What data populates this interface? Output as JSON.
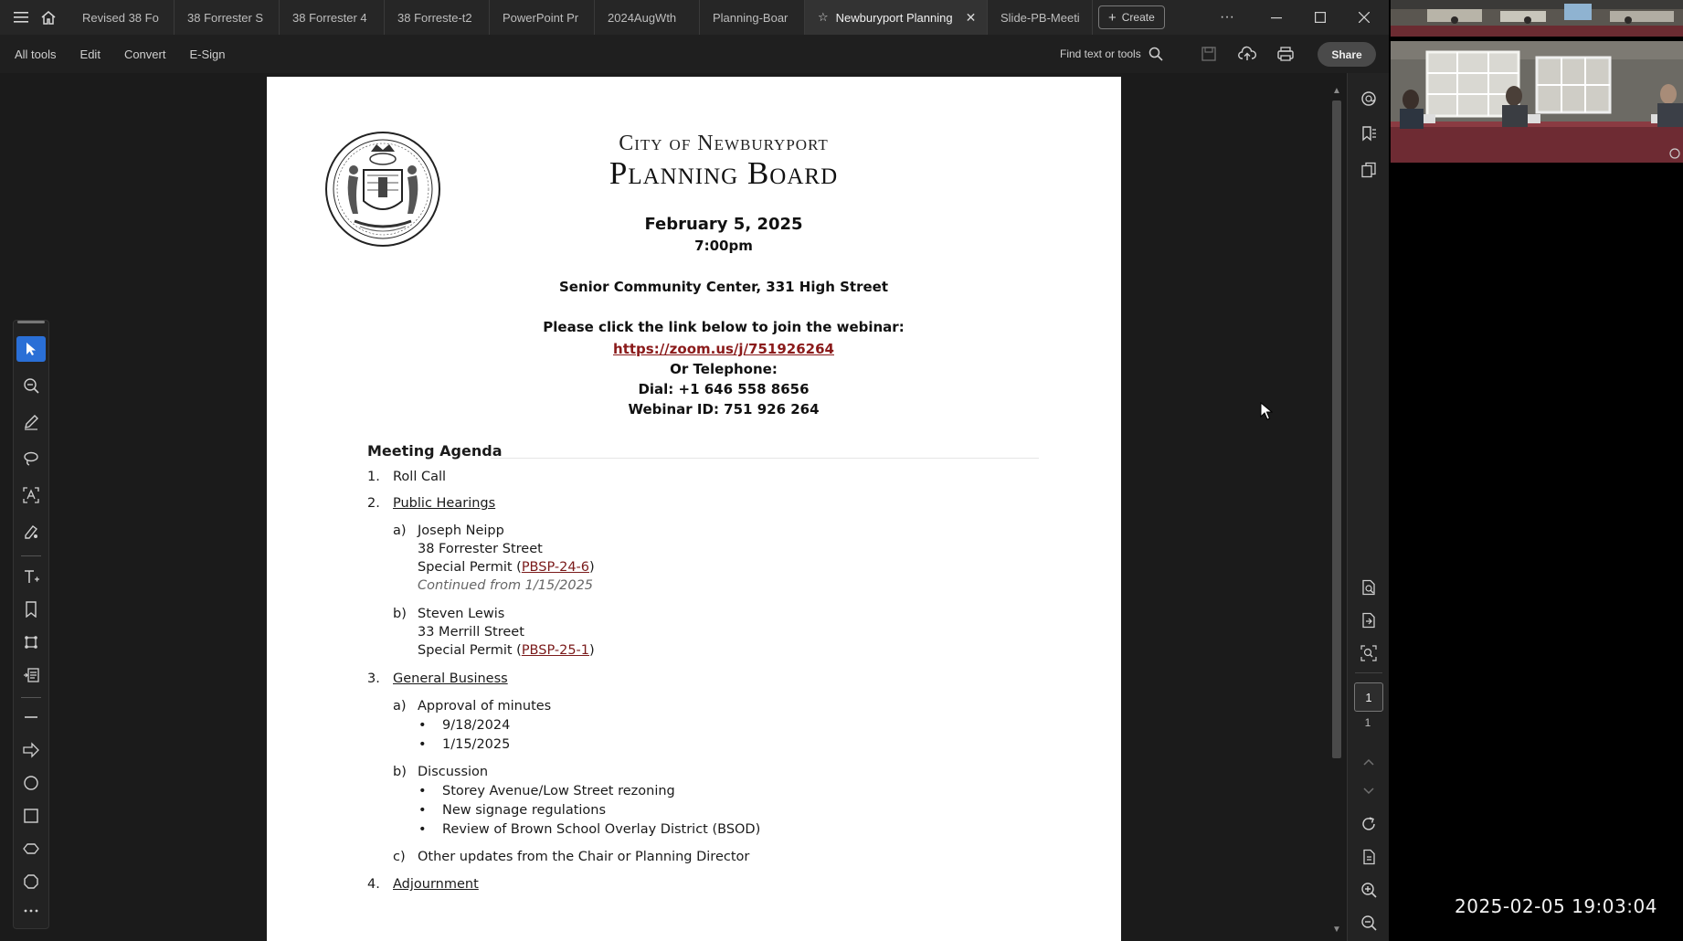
{
  "tabbar": {
    "tabs": [
      {
        "label": "Revised 38 Fo",
        "active": false
      },
      {
        "label": "38 Forrester S",
        "active": false
      },
      {
        "label": "38 Forrester 4",
        "active": false
      },
      {
        "label": "38 Forreste-t2",
        "active": false
      },
      {
        "label": "PowerPoint Pr",
        "active": false
      },
      {
        "label": "2024AugWth",
        "active": false
      },
      {
        "label": "Planning-Boar",
        "active": false
      },
      {
        "label": "Newburyport Planning",
        "active": true
      },
      {
        "label": "Slide-PB-Meeti",
        "active": false
      }
    ],
    "create_label": "Create",
    "more_label": "···"
  },
  "menubar": {
    "items": [
      "All tools",
      "Edit",
      "Convert",
      "E-Sign"
    ],
    "find_label": "Find text or tools",
    "share_label": "Share"
  },
  "document": {
    "city": "City of Newburyport",
    "board": "Planning Board",
    "date": "February 5, 2025",
    "time": "7:00pm",
    "location": "Senior Community Center, 331 High Street",
    "webinar_prompt": "Please click the link below to join the webinar:",
    "webinar_link": "https://zoom.us/j/751926264",
    "or_telephone": "Or Telephone:",
    "dial": "Dial: +1 646 558 8656",
    "webinar_id": "Webinar ID: 751 926 264",
    "agenda_title": "Meeting Agenda",
    "items": {
      "i1_num": "1.",
      "i1_label": "Roll Call",
      "i2_num": "2.",
      "i2_label": "Public Hearings",
      "i2a_letter": "a)",
      "i2a_name": "Joseph Neipp",
      "i2a_address": "38 Forrester Street",
      "i2a_permit_prefix": "Special Permit (",
      "i2a_permit_code": "PBSP-24-6",
      "i2a_permit_suffix": ")",
      "i2a_note": "Continued from 1/15/2025",
      "i2b_letter": "b)",
      "i2b_name": "Steven Lewis",
      "i2b_address": "33 Merrill Street",
      "i2b_permit_prefix": "Special Permit (",
      "i2b_permit_code": "PBSP-25-1",
      "i2b_permit_suffix": ")",
      "i3_num": "3.",
      "i3_label": "General Business",
      "i3a_letter": "a)",
      "i3a_label": "Approval of minutes",
      "i3a_b1": "9/18/2024",
      "i3a_b2": "1/15/2025",
      "i3b_letter": "b)",
      "i3b_label": "Discussion",
      "i3b_b1": "Storey Avenue/Low Street rezoning",
      "i3b_b2": "New signage regulations",
      "i3b_b3": "Review of Brown School Overlay District (BSOD)",
      "i3c_letter": "c)",
      "i3c_label": "Other updates from the Chair or Planning Director",
      "i4_num": "4.",
      "i4_label": "Adjournment"
    },
    "bullet": "•"
  },
  "right_panel": {
    "current_page": "1",
    "total_pages": "1"
  },
  "overlay": {
    "timestamp": "2025-02-05 19:03:04"
  },
  "colors": {
    "accent": "#2a6fd6",
    "link": "#8a1a1a"
  }
}
